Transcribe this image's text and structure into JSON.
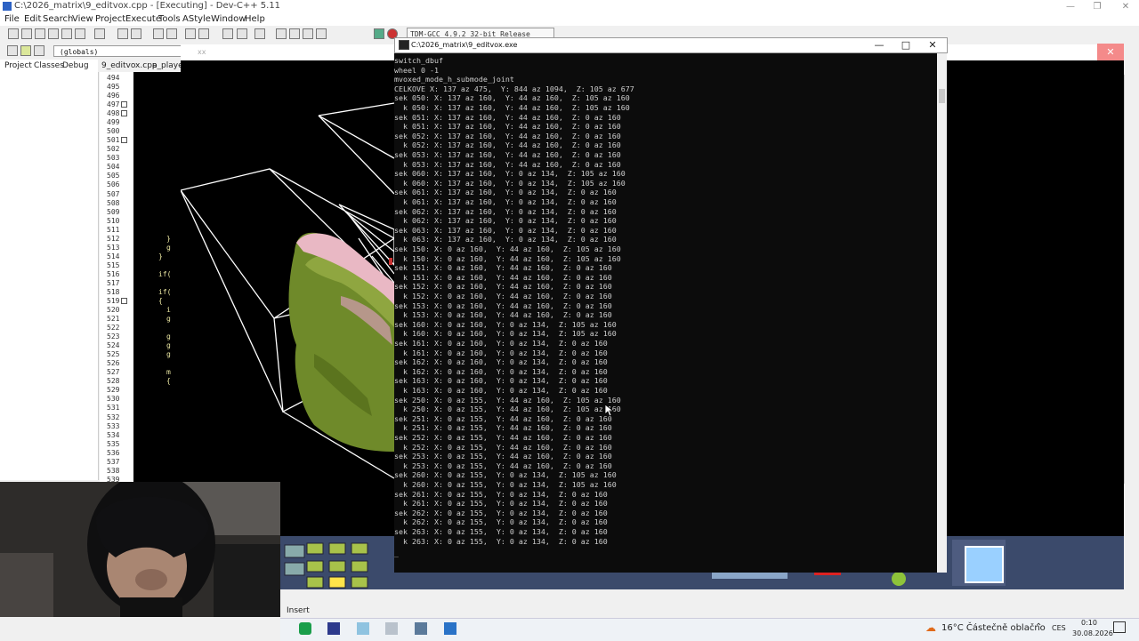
{
  "devcpp": {
    "title": "C:\\2026_matrix\\9_editvox.cpp - [Executing] - Dev-C++ 5.11",
    "menu": [
      "File",
      "Edit",
      "Search",
      "View",
      "Project",
      "Execute",
      "Tools",
      "AStyle",
      "Window",
      "Help"
    ],
    "compiler": "TDM-GCC 4.9.2 32-bit Release",
    "scope": "(globals)",
    "panel_tabs": [
      "Project",
      "Classes",
      "Debug"
    ],
    "editor_tabs": [
      "9_editvox.cpp",
      "a_player."
    ],
    "line_numbers": [
      "494",
      "495",
      "496",
      "497",
      "498",
      "499",
      "500",
      "501",
      "502",
      "503",
      "504",
      "505",
      "506",
      "507",
      "508",
      "509",
      "510",
      "511",
      "512",
      "513",
      "514",
      "515",
      "516",
      "517",
      "518",
      "519",
      "520",
      "521",
      "522",
      "523",
      "524",
      "525",
      "526",
      "527",
      "528",
      "529",
      "530",
      "531",
      "532",
      "533",
      "534",
      "535",
      "536",
      "537",
      "538",
      "539"
    ],
    "code_fragments": [
      "}",
      "g",
      "}",
      "if(",
      "if(",
      "{",
      "i",
      "g",
      "g",
      "g",
      "g",
      "m",
      "{"
    ],
    "status": "Insert"
  },
  "game_window": {
    "title": "xx",
    "close_label": "✕"
  },
  "console": {
    "title": "C:\\2026_matrix\\9_editvox.exe",
    "minimize_label": "—",
    "maximize_label": "□",
    "close_label": "✕",
    "lines": [
      "switch_dbuf",
      "wheel 0 -1",
      "mvoxed_mode_h_submode_joint",
      "CELKOVE X: 137 az 475,  Y: 844 az 1094,  Z: 105 az 677",
      "sek 050: X: 137 az 160,  Y: 44 az 160,  Z: 105 az 160",
      "  k 050: X: 137 az 160,  Y: 44 az 160,  Z: 105 az 160",
      "sek 051: X: 137 az 160,  Y: 44 az 160,  Z: 0 az 160",
      "  k 051: X: 137 az 160,  Y: 44 az 160,  Z: 0 az 160",
      "sek 052: X: 137 az 160,  Y: 44 az 160,  Z: 0 az 160",
      "  k 052: X: 137 az 160,  Y: 44 az 160,  Z: 0 az 160",
      "sek 053: X: 137 az 160,  Y: 44 az 160,  Z: 0 az 160",
      "  k 053: X: 137 az 160,  Y: 44 az 160,  Z: 0 az 160",
      "sek 060: X: 137 az 160,  Y: 0 az 134,  Z: 105 az 160",
      "  k 060: X: 137 az 160,  Y: 0 az 134,  Z: 105 az 160",
      "sek 061: X: 137 az 160,  Y: 0 az 134,  Z: 0 az 160",
      "  k 061: X: 137 az 160,  Y: 0 az 134,  Z: 0 az 160",
      "sek 062: X: 137 az 160,  Y: 0 az 134,  Z: 0 az 160",
      "  k 062: X: 137 az 160,  Y: 0 az 134,  Z: 0 az 160",
      "sek 063: X: 137 az 160,  Y: 0 az 134,  Z: 0 az 160",
      "  k 063: X: 137 az 160,  Y: 0 az 134,  Z: 0 az 160",
      "sek 150: X: 0 az 160,  Y: 44 az 160,  Z: 105 az 160",
      "  k 150: X: 0 az 160,  Y: 44 az 160,  Z: 105 az 160",
      "sek 151: X: 0 az 160,  Y: 44 az 160,  Z: 0 az 160",
      "  k 151: X: 0 az 160,  Y: 44 az 160,  Z: 0 az 160",
      "sek 152: X: 0 az 160,  Y: 44 az 160,  Z: 0 az 160",
      "  k 152: X: 0 az 160,  Y: 44 az 160,  Z: 0 az 160",
      "sek 153: X: 0 az 160,  Y: 44 az 160,  Z: 0 az 160",
      "  k 153: X: 0 az 160,  Y: 44 az 160,  Z: 0 az 160",
      "sek 160: X: 0 az 160,  Y: 0 az 134,  Z: 105 az 160",
      "  k 160: X: 0 az 160,  Y: 0 az 134,  Z: 105 az 160",
      "sek 161: X: 0 az 160,  Y: 0 az 134,  Z: 0 az 160",
      "  k 161: X: 0 az 160,  Y: 0 az 134,  Z: 0 az 160",
      "sek 162: X: 0 az 160,  Y: 0 az 134,  Z: 0 az 160",
      "  k 162: X: 0 az 160,  Y: 0 az 134,  Z: 0 az 160",
      "sek 163: X: 0 az 160,  Y: 0 az 134,  Z: 0 az 160",
      "  k 163: X: 0 az 160,  Y: 0 az 134,  Z: 0 az 160",
      "sek 250: X: 0 az 155,  Y: 44 az 160,  Z: 105 az 160",
      "  k 250: X: 0 az 155,  Y: 44 az 160,  Z: 105 az 160",
      "sek 251: X: 0 az 155,  Y: 44 az 160,  Z: 0 az 160",
      "  k 251: X: 0 az 155,  Y: 44 az 160,  Z: 0 az 160",
      "sek 252: X: 0 az 155,  Y: 44 az 160,  Z: 0 az 160",
      "  k 252: X: 0 az 155,  Y: 44 az 160,  Z: 0 az 160",
      "sek 253: X: 0 az 155,  Y: 44 az 160,  Z: 0 az 160",
      "  k 253: X: 0 az 155,  Y: 44 az 160,  Z: 0 az 160",
      "sek 260: X: 0 az 155,  Y: 0 az 134,  Z: 105 az 160",
      "  k 260: X: 0 az 155,  Y: 0 az 134,  Z: 105 az 160",
      "sek 261: X: 0 az 155,  Y: 0 az 134,  Z: 0 az 160",
      "  k 261: X: 0 az 155,  Y: 0 az 134,  Z: 0 az 160",
      "sek 262: X: 0 az 155,  Y: 0 az 134,  Z: 0 az 160",
      "  k 262: X: 0 az 155,  Y: 0 az 134,  Z: 0 az 160",
      "sek 263: X: 0 az 155,  Y: 0 az 134,  Z: 0 az 160",
      "  k 263: X: 0 az 155,  Y: 0 az 134,  Z: 0 az 160"
    ],
    "cursor": "_"
  },
  "taskbar": {
    "weather": "16°C  Částečně oblačno",
    "language": "CES",
    "time": "0:10",
    "date": "30.08.2026"
  },
  "colors": {
    "console_bg": "#0c0c0c",
    "console_text": "#cfcfcf",
    "voxel_green": "#6f8a2a",
    "voxel_pink": "#e9b8c4",
    "hud_blue": "#3b4a6b"
  }
}
